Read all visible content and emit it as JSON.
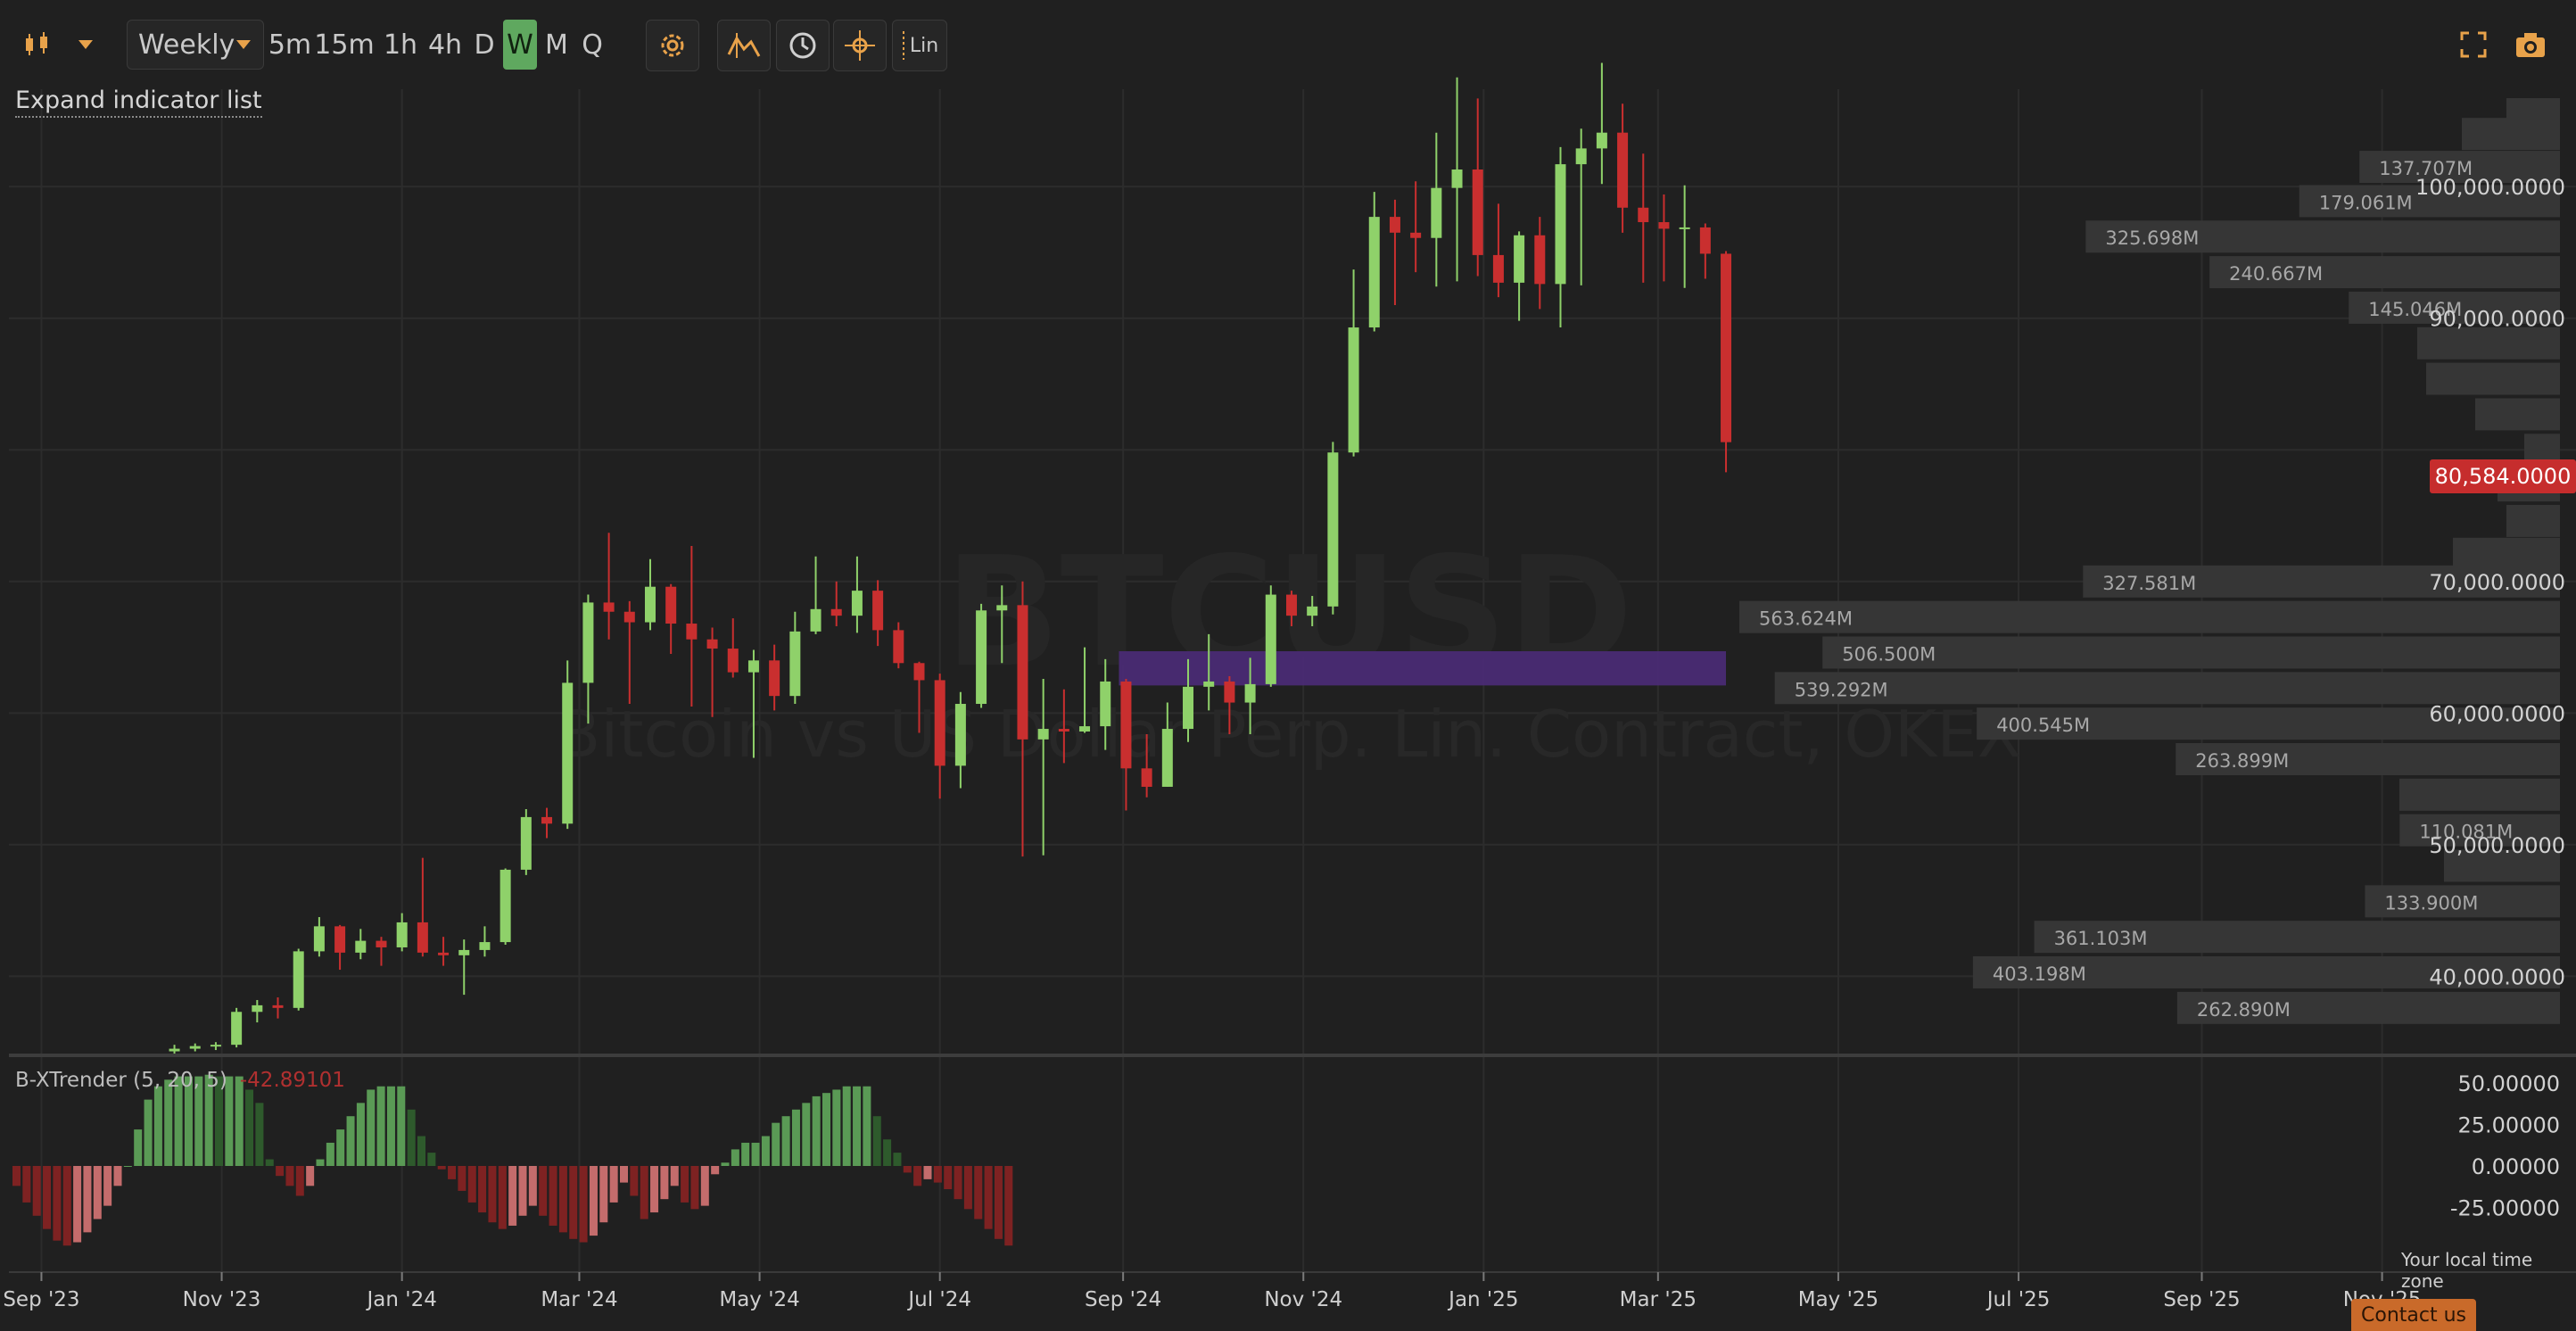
{
  "toolbar": {
    "chart_type_icon": "candlestick-icon",
    "interval_selected": "Weekly",
    "intervals": [
      "5m",
      "15m",
      "1h",
      "4h",
      "D",
      "W",
      "M",
      "Q"
    ],
    "active_interval": "W",
    "scale_label": "Lin",
    "icons": [
      "gear-icon",
      "indicators-icon",
      "clock-icon",
      "crosshair-icon",
      "fullscreen-icon",
      "camera-icon"
    ]
  },
  "expand_indicator_list": "Expand indicator list",
  "watermark": {
    "symbol": "BTCUSD",
    "description": "Bitcoin vs US Dollar Perp. Lin. Contract, OKEX"
  },
  "price_axis": [
    "100,000.0000",
    "90,000.0000",
    "70,000.0000",
    "60,000.0000",
    "50,000.0000",
    "40,000.0000"
  ],
  "current_price": "80,584.0000",
  "volume_profile_labels": [
    {
      "text": "137.707M",
      "price": 101500
    },
    {
      "text": "179.061M",
      "price": 98900
    },
    {
      "text": "325.698M",
      "price": 96200
    },
    {
      "text": "240.667M",
      "price": 93500
    },
    {
      "text": "145.046M",
      "price": 90800
    },
    {
      "text": "327.581M",
      "price": 70000
    },
    {
      "text": "563.624M",
      "price": 67300
    },
    {
      "text": "506.500M",
      "price": 64600
    },
    {
      "text": "539.292M",
      "price": 61900
    },
    {
      "text": "400.545M",
      "price": 59200
    },
    {
      "text": "263.899M",
      "price": 56500
    },
    {
      "text": "110.081M",
      "price": 51100
    },
    {
      "text": "133.900M",
      "price": 45700
    },
    {
      "text": "361.103M",
      "price": 43000
    },
    {
      "text": "403.198M",
      "price": 40300
    },
    {
      "text": "262.890M",
      "price": 37600
    }
  ],
  "indicator": {
    "name": "B-XTrender (5, 20, 5)",
    "value": "-42.89101",
    "axis": [
      "50.00000",
      "25.00000",
      "0.00000",
      "-25.00000"
    ]
  },
  "time_axis": [
    "Sep '23",
    "Nov '23",
    "Jan '24",
    "Mar '24",
    "May '24",
    "Jul '24",
    "Sep '24",
    "Nov '24",
    "Jan '25",
    "Mar '25",
    "May '25",
    "Jul '25",
    "Sep '25",
    "Nov '25"
  ],
  "timezone_note": "Your local time zone",
  "contact_us": "Contact us",
  "colors": {
    "up": "#8fd16a",
    "down": "#c92f2f",
    "osc_up_strong": "#5a9a55",
    "osc_up_weak": "#2e5a2c",
    "osc_down_strong": "#7e2222",
    "osc_down_weak": "#c46c6c",
    "zone": "#4b2b78"
  },
  "chart_data": [
    {
      "type": "candlestick",
      "interval": "Weekly",
      "x_range": [
        "2023-08-21",
        "2025-12-01"
      ],
      "y_range": [
        34200,
        107400
      ],
      "candles": [
        [
          "2023-10-16",
          34300,
          34800,
          34100,
          34500
        ],
        [
          "2023-10-23",
          34500,
          34900,
          34300,
          34700
        ],
        [
          "2023-10-30",
          34700,
          35000,
          34400,
          34800
        ],
        [
          "2023-11-06",
          34800,
          37600,
          34600,
          37300
        ],
        [
          "2023-11-13",
          37300,
          38200,
          36500,
          37800
        ],
        [
          "2023-11-20",
          37800,
          38400,
          36800,
          37600
        ],
        [
          "2023-11-27",
          37600,
          42100,
          37400,
          41900
        ],
        [
          "2023-12-04",
          41900,
          44500,
          41500,
          43800
        ],
        [
          "2023-12-11",
          43800,
          43900,
          40500,
          41800
        ],
        [
          "2023-12-18",
          41800,
          43600,
          41300,
          42700
        ],
        [
          "2023-12-25",
          42700,
          43000,
          40800,
          42200
        ],
        [
          "2024-01-01",
          42200,
          44800,
          41900,
          44100
        ],
        [
          "2024-01-08",
          44100,
          49000,
          41500,
          41800
        ],
        [
          "2024-01-15",
          41800,
          43000,
          40800,
          41600
        ],
        [
          "2024-01-22",
          41600,
          42800,
          38600,
          42000
        ],
        [
          "2024-01-29",
          42000,
          43800,
          41500,
          42600
        ],
        [
          "2024-02-05",
          42600,
          48200,
          42400,
          48100
        ],
        [
          "2024-02-12",
          48100,
          52700,
          47700,
          52100
        ],
        [
          "2024-02-19",
          52100,
          52800,
          50500,
          51600
        ],
        [
          "2024-02-26",
          51600,
          64000,
          51200,
          62300
        ],
        [
          "2024-03-04",
          62300,
          69000,
          59200,
          68400
        ],
        [
          "2024-03-11",
          68400,
          73700,
          65600,
          67700
        ],
        [
          "2024-03-18",
          67700,
          68500,
          60700,
          66900
        ],
        [
          "2024-03-25",
          66900,
          71700,
          66300,
          69600
        ],
        [
          "2024-04-01",
          69600,
          69800,
          64500,
          66800
        ],
        [
          "2024-04-08",
          66800,
          72700,
          60500,
          65600
        ],
        [
          "2024-04-15",
          65600,
          66500,
          59700,
          64900
        ],
        [
          "2024-04-22",
          64900,
          67200,
          62700,
          63100
        ],
        [
          "2024-04-29",
          63100,
          64800,
          56600,
          64000
        ],
        [
          "2024-05-06",
          64000,
          65200,
          60200,
          61300
        ],
        [
          "2024-05-13",
          61300,
          67700,
          60700,
          66200
        ],
        [
          "2024-05-20",
          66200,
          71900,
          66000,
          67900
        ],
        [
          "2024-05-27",
          67900,
          70000,
          66600,
          67400
        ],
        [
          "2024-06-03",
          67400,
          71900,
          66100,
          69300
        ],
        [
          "2024-06-10",
          69300,
          70100,
          65100,
          66300
        ],
        [
          "2024-06-17",
          66300,
          66900,
          63400,
          63800
        ],
        [
          "2024-06-24",
          63800,
          63900,
          58500,
          62500
        ],
        [
          "2024-07-01",
          62500,
          63000,
          53500,
          56000
        ],
        [
          "2024-07-08",
          56000,
          61600,
          54300,
          60700
        ],
        [
          "2024-07-15",
          60700,
          68300,
          60400,
          67800
        ],
        [
          "2024-07-22",
          67800,
          69700,
          63800,
          68200
        ],
        [
          "2024-07-29",
          68200,
          70000,
          49100,
          58000
        ],
        [
          "2024-08-05",
          58000,
          62600,
          49200,
          58800
        ],
        [
          "2024-08-12",
          58800,
          61800,
          56200,
          58600
        ],
        [
          "2024-08-19",
          58600,
          65000,
          58500,
          59000
        ],
        [
          "2024-08-26",
          59000,
          64100,
          57200,
          62400
        ],
        [
          "2024-09-02",
          62400,
          62600,
          52600,
          55800
        ],
        [
          "2024-09-09",
          55800,
          58400,
          53600,
          54400
        ],
        [
          "2024-09-16",
          54400,
          60800,
          54400,
          58800
        ],
        [
          "2024-09-23",
          58800,
          64100,
          57800,
          62000
        ],
        [
          "2024-09-30",
          62000,
          66000,
          60200,
          62400
        ],
        [
          "2024-10-07",
          62400,
          62800,
          58400,
          60800
        ],
        [
          "2024-10-14",
          60800,
          64200,
          58400,
          62200
        ],
        [
          "2024-10-21",
          62200,
          69700,
          62000,
          69000
        ],
        [
          "2024-10-28",
          69000,
          69300,
          66600,
          67400
        ],
        [
          "2024-11-04",
          67400,
          68900,
          66600,
          68100
        ],
        [
          "2024-11-11",
          68100,
          80600,
          67500,
          79800
        ],
        [
          "2024-11-18",
          79800,
          93700,
          79500,
          89300
        ],
        [
          "2024-11-25",
          89300,
          99600,
          89000,
          97700
        ],
        [
          "2024-12-02",
          97700,
          99000,
          91000,
          96500
        ],
        [
          "2024-12-09",
          96500,
          100400,
          93500,
          96100
        ],
        [
          "2024-12-16",
          96100,
          104100,
          92400,
          99900
        ],
        [
          "2024-12-23",
          99900,
          108300,
          92800,
          101300
        ],
        [
          "2024-12-30",
          101300,
          106700,
          93200,
          94800
        ],
        [
          "2025-01-06",
          94800,
          98700,
          91600,
          92700
        ],
        [
          "2025-01-13",
          92700,
          96600,
          89800,
          96300
        ],
        [
          "2025-01-20",
          96300,
          97700,
          90700,
          92600
        ],
        [
          "2025-01-27",
          92600,
          103000,
          89300,
          101700
        ],
        [
          "2025-02-03",
          101700,
          104400,
          92500,
          102900
        ],
        [
          "2025-02-10",
          102900,
          109400,
          100200,
          104100
        ],
        [
          "2025-02-17",
          104100,
          106300,
          96500,
          98400
        ],
        [
          "2025-02-24",
          98400,
          102500,
          92700,
          97300
        ],
        [
          "2025-03-03",
          97300,
          99400,
          92800,
          96800
        ],
        [
          "2025-03-10",
          96800,
          100100,
          92300,
          96900
        ],
        [
          "2025-03-17",
          96900,
          97200,
          93000,
          94900
        ],
        [
          "2025-03-24",
          94900,
          95100,
          78300,
          80584
        ]
      ],
      "zone": {
        "from": "2024-09-02",
        "to": "2025-04-07",
        "price_low": 62100,
        "price_high": 64700
      }
    },
    {
      "type": "bar",
      "name": "B-XTrender (5, 20, 5)",
      "y_range": [
        -64,
        64
      ],
      "values": [
        -12,
        -22,
        -30,
        -38,
        -45,
        -48,
        -46,
        -40,
        -32,
        -24,
        -12,
        0,
        22,
        40,
        48,
        52,
        54,
        54,
        54,
        55,
        54,
        54,
        54,
        46,
        38,
        4,
        -6,
        -12,
        -18,
        -12,
        4,
        14,
        22,
        30,
        38,
        46,
        48,
        48,
        48,
        34,
        18,
        8,
        -2,
        -8,
        -15,
        -22,
        -28,
        -34,
        -38,
        -36,
        -30,
        -24,
        -30,
        -36,
        -40,
        -44,
        -46,
        -42,
        -34,
        -22,
        -10,
        -18,
        -32,
        -28,
        -20,
        -12,
        -22,
        -26,
        -24,
        -5,
        2,
        10,
        14,
        14,
        18,
        26,
        30,
        34,
        38,
        42,
        44,
        46,
        48,
        48,
        48,
        30,
        16,
        8,
        -4,
        -12,
        -8,
        -10,
        -14,
        -20,
        -26,
        -32,
        -38,
        -44,
        -48
      ]
    }
  ]
}
